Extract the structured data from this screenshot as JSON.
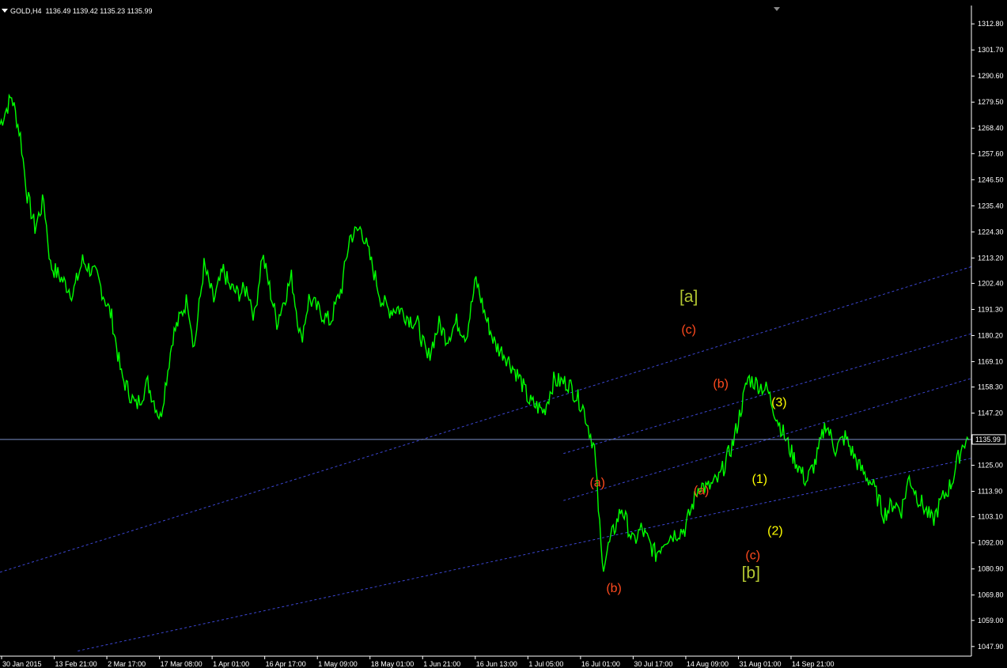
{
  "header": {
    "symbol_label": "GOLD,H4",
    "ohlc_text": "1136.49 1139.42 1135.23 1135.99"
  },
  "colors": {
    "background": "#000000",
    "axis": "#ffffff",
    "price_line": "#00ff00",
    "channel_lines": "#3c46d2",
    "current_price_line": "#7a8fc8",
    "wave_letters": "#ff4a1e",
    "wave_major": "#b4c832",
    "wave_numbers": "#ffff00"
  },
  "chart_data": {
    "type": "line",
    "title": "",
    "xlabel": "",
    "ylabel": "",
    "ylim": [
      1043.8,
      1320.6
    ],
    "y_ticks": [
      "1312.80",
      "1301.70",
      "1290.60",
      "1279.50",
      "1268.40",
      "1257.60",
      "1246.50",
      "1235.40",
      "1224.30",
      "1213.20",
      "1202.40",
      "1191.30",
      "1180.20",
      "1169.10",
      "1158.30",
      "1147.20",
      "1125.00",
      "1113.90",
      "1103.10",
      "1092.00",
      "1080.90",
      "1069.80",
      "1059.00",
      "1047.90"
    ],
    "x_ticks": [
      "30 Jan 2015",
      "13 Feb 21:00",
      "2 Mar 17:00",
      "17 Mar 08:00",
      "1 Apr 01:00",
      "16 Apr 17:00",
      "1 May 09:00",
      "18 May 01:00",
      "1 Jun 21:00",
      "16 Jun 13:00",
      "1 Jul 05:00",
      "16 Jul 01:00",
      "30 Jul 17:00",
      "14 Aug 09:00",
      "31 Aug 01:00",
      "14 Sep 21:00"
    ],
    "current_price": "1135.99",
    "grid": false,
    "series": [
      {
        "x": [
          0,
          0.012,
          0.021,
          0.028,
          0.036,
          0.045,
          0.052,
          0.062,
          0.075,
          0.085,
          0.1,
          0.115,
          0.125,
          0.14,
          0.152,
          0.165,
          0.178,
          0.193,
          0.2,
          0.21,
          0.22,
          0.23,
          0.236,
          0.245,
          0.255,
          0.262,
          0.27,
          0.285,
          0.3,
          0.31,
          0.318,
          0.33,
          0.34,
          0.352,
          0.36,
          0.372,
          0.385,
          0.392,
          0.4,
          0.41,
          0.42,
          0.43,
          0.44,
          0.452,
          0.46,
          0.47,
          0.48,
          0.49,
          0.5,
          0.51,
          0.52,
          0.535,
          0.545,
          0.56,
          0.57,
          0.585,
          0.6,
          0.612,
          0.62,
          0.63,
          0.64,
          0.652,
          0.66,
          0.675,
          0.685,
          0.705,
          0.72,
          0.728,
          0.74,
          0.755,
          0.77,
          0.79,
          0.8,
          0.815,
          0.83,
          0.84,
          0.85,
          0.86,
          0.87,
          0.885,
          0.898,
          0.91,
          0.92,
          0.928,
          0.936,
          0.944,
          0.95,
          0.96,
          0.968,
          0.975,
          0.98,
          0.985,
          0.992,
          0.998
        ],
        "y": [
          1270,
          1282,
          1265,
          1240,
          1226,
          1238,
          1210,
          1205,
          1198,
          1212,
          1205,
          1188,
          1163,
          1150,
          1160,
          1145,
          1180,
          1196,
          1175,
          1210,
          1195,
          1208,
          1201,
          1198,
          1200,
          1188,
          1215,
          1186,
          1205,
          1178,
          1196,
          1190,
          1186,
          1201,
          1222,
          1226,
          1207,
          1196,
          1191,
          1192,
          1188,
          1185,
          1170,
          1185,
          1179,
          1186,
          1180,
          1204,
          1188,
          1176,
          1172,
          1162,
          1152,
          1148,
          1161,
          1160,
          1150,
          1132,
          1082,
          1095,
          1107,
          1092,
          1098,
          1087,
          1094,
          1098,
          1117,
          1115,
          1119,
          1135,
          1162,
          1157,
          1145,
          1130,
          1118,
          1127,
          1143,
          1132,
          1137,
          1124,
          1117,
          1104,
          1109,
          1106,
          1120,
          1112,
          1108,
          1101,
          1109,
          1114,
          1118,
          1126,
          1135,
          1136
        ],
        "note": ""
      }
    ],
    "channels": [
      {
        "start": [
          0,
          1079.5
        ],
        "end": [
          1,
          1209.5
        ]
      },
      {
        "start": [
          0.58,
          1130
        ],
        "end": [
          1,
          1181
        ]
      },
      {
        "start": [
          0.58,
          1110
        ],
        "end": [
          1,
          1162
        ]
      },
      {
        "start": [
          0.08,
          1046
        ],
        "end": [
          1,
          1128
        ]
      }
    ],
    "annotations": [
      {
        "text": "[a]",
        "x": 0.709,
        "y": 1194.5,
        "kind": "major"
      },
      {
        "text": "(c)",
        "x": 0.709,
        "y": 1181.0,
        "kind": "letter"
      },
      {
        "text": "(b)",
        "x": 0.742,
        "y": 1158.0,
        "kind": "letter"
      },
      {
        "text": "(3)",
        "x": 0.802,
        "y": 1150.0,
        "kind": "number"
      },
      {
        "text": "(a)",
        "x": 0.615,
        "y": 1116.0,
        "kind": "letter"
      },
      {
        "text": "(a)",
        "x": 0.722,
        "y": 1112.5,
        "kind": "letter"
      },
      {
        "text": "(1)",
        "x": 0.782,
        "y": 1117.5,
        "kind": "number"
      },
      {
        "text": "(2)",
        "x": 0.798,
        "y": 1095.5,
        "kind": "number"
      },
      {
        "text": "(c)",
        "x": 0.775,
        "y": 1085.0,
        "kind": "letter"
      },
      {
        "text": "[b]",
        "x": 0.773,
        "y": 1077.0,
        "kind": "major"
      },
      {
        "text": "(b)",
        "x": 0.632,
        "y": 1071.0,
        "kind": "letter"
      }
    ]
  }
}
